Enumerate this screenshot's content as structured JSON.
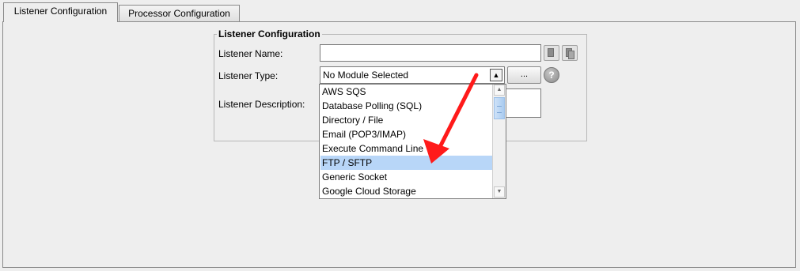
{
  "tabs": [
    {
      "label": "Listener Configuration"
    },
    {
      "label": "Processor Configuration"
    }
  ],
  "group": {
    "title": "Listener Configuration",
    "name_label": "Listener Name:",
    "name_value": "",
    "type_label": "Listener Type:",
    "type_value": "No Module Selected",
    "desc_label": "Listener Description:",
    "ellipsis_label": "...",
    "help_glyph": "?"
  },
  "dropdown": {
    "selected_index": 5,
    "items": [
      {
        "label": "AWS SQS"
      },
      {
        "label": "Database Polling (SQL)"
      },
      {
        "label": "Directory / File"
      },
      {
        "label": "Email (POP3/IMAP)"
      },
      {
        "label": "Execute Command Line"
      },
      {
        "label": "FTP / SFTP"
      },
      {
        "label": "Generic Socket"
      },
      {
        "label": "Google Cloud Storage"
      }
    ]
  },
  "annotation": {
    "color": "#ff1a1a"
  },
  "colors": {
    "highlight": "#b8d6f8",
    "background": "#eeeeee"
  }
}
